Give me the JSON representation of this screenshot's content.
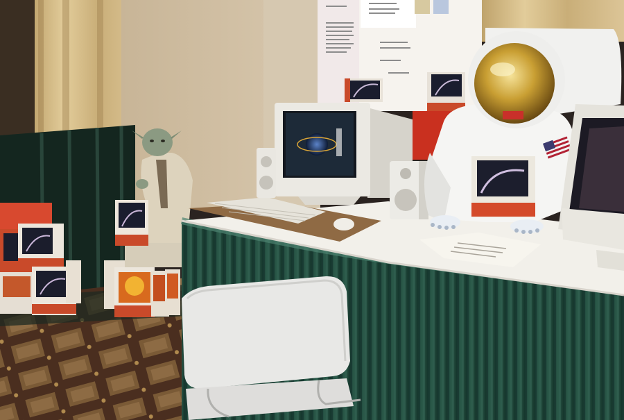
{
  "scene": {
    "colors": {
      "curtain": "#d9c59a",
      "wall": "#cdbb9e",
      "skirt": "#1f4a3c",
      "table_top": "#f1efe9",
      "carpet": "#5a3a26",
      "red_box": "#d8492f",
      "helmet_visor": "#c9a23a"
    },
    "objects": [
      "curtain-backdrop-icon",
      "yoda-figure-icon",
      "astronaut-suit-icon",
      "crt-monitor-icon",
      "keyboard-icon",
      "speaker-icon",
      "software-box-icon",
      "white-chair-icon",
      "table-skirt-icon",
      "poster-board-icon",
      "american-flag-icon"
    ]
  }
}
